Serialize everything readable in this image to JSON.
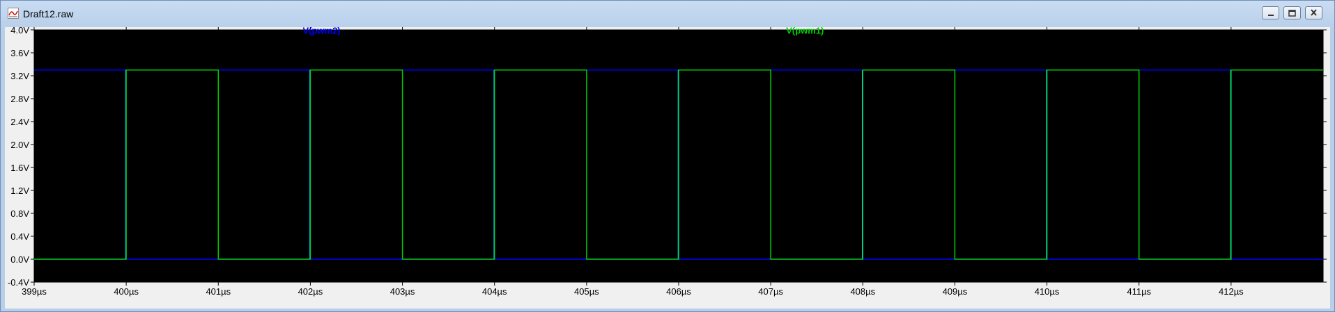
{
  "window": {
    "title": "Draft12.raw",
    "buttons": {
      "minimize": "minimize",
      "maximize": "maximize",
      "close": "close"
    }
  },
  "colors": {
    "background": "#000000",
    "pwm1": "#00d000",
    "pwm2": "#0000ff",
    "pwm2_edge": "#00bfff",
    "grid_border": "#000000"
  },
  "chart_data": {
    "type": "line",
    "title": "",
    "xlabel": "",
    "ylabel": "",
    "xlim": [
      399,
      413
    ],
    "ylim": [
      -0.4,
      4.0
    ],
    "x_unit": "µs",
    "y_unit": "V",
    "x_ticks": [
      399,
      400,
      401,
      402,
      403,
      404,
      405,
      406,
      407,
      408,
      409,
      410,
      411,
      412
    ],
    "x_tick_labels": [
      "399µs",
      "400µs",
      "401µs",
      "402µs",
      "403µs",
      "404µs",
      "405µs",
      "406µs",
      "407µs",
      "408µs",
      "409µs",
      "410µs",
      "411µs",
      "412µs"
    ],
    "y_ticks": [
      4.0,
      3.6,
      3.2,
      2.8,
      2.4,
      2.0,
      1.6,
      1.2,
      0.8,
      0.4,
      0.0,
      -0.4
    ],
    "y_tick_labels": [
      "4.0V",
      "3.6V",
      "3.2V",
      "2.8V",
      "2.4V",
      "2.0V",
      "1.6V",
      "1.2V",
      "0.8V",
      "0.4V",
      "0.0V",
      "-0.4V"
    ],
    "grid": false,
    "series": [
      {
        "name": "V(pwm2)",
        "color": "#0000ff",
        "x": [
          399,
          413,
          413,
          399
        ],
        "y": [
          3.3,
          3.3,
          0.0,
          0.0
        ],
        "segments": [
          {
            "x": [
              399,
              413
            ],
            "y": [
              3.3,
              3.3
            ]
          },
          {
            "x": [
              399,
              413
            ],
            "y": [
              0.0,
              0.0
            ]
          }
        ]
      },
      {
        "name": "V(pwm1)",
        "color": "#00d000",
        "x": [
          399,
          400,
          400,
          401,
          401,
          402,
          402,
          403,
          403,
          404,
          404,
          405,
          405,
          406,
          406,
          407,
          407,
          408,
          408,
          409,
          409,
          410,
          410,
          411,
          411,
          412,
          412,
          413
        ],
        "y": [
          0,
          0,
          3.3,
          3.3,
          0,
          0,
          3.3,
          3.3,
          0,
          0,
          3.3,
          3.3,
          0,
          0,
          3.3,
          3.3,
          0,
          0,
          3.3,
          3.3,
          0,
          0,
          3.3,
          3.3,
          0,
          0,
          3.3,
          3.3
        ]
      }
    ],
    "legend": [
      {
        "label": "V(pwm2)",
        "color": "#0000ff"
      },
      {
        "label": "V(pwm1)",
        "color": "#00d000"
      }
    ]
  }
}
